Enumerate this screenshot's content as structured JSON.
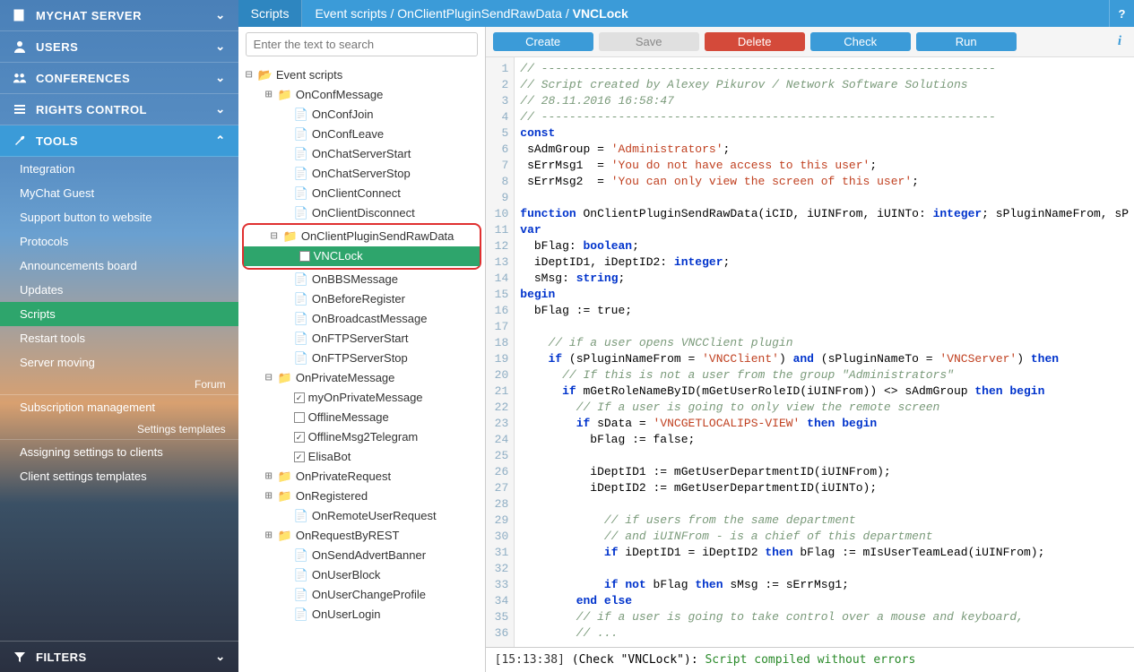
{
  "sidebar": {
    "sections": [
      {
        "label": "MYCHAT SERVER",
        "icon": "book",
        "expanded": false
      },
      {
        "label": "USERS",
        "icon": "user",
        "expanded": false
      },
      {
        "label": "CONFERENCES",
        "icon": "users",
        "expanded": false
      },
      {
        "label": "RIGHTS CONTROL",
        "icon": "list",
        "expanded": false
      },
      {
        "label": "TOOLS",
        "icon": "wrench",
        "expanded": true
      }
    ],
    "tools_items": [
      "Integration",
      "MyChat Guest",
      "Support button to website",
      "Protocols",
      "Announcements board",
      "Updates",
      "Scripts",
      "Restart tools",
      "Server moving"
    ],
    "tools_active": "Scripts",
    "forum_label": "Forum",
    "subscription": "Subscription management",
    "settings_templates": "Settings templates",
    "assigning": "Assigning settings to clients",
    "client_templates": "Client settings templates",
    "filters": "FILTERS"
  },
  "topbar": {
    "tab": "Scripts",
    "breadcrumb": "Event scripts / OnClientPluginSendRawData / VNCLock",
    "breadcrumb_parts": [
      "Event scripts",
      "OnClientPluginSendRawData",
      "VNCLock"
    ],
    "help": "?"
  },
  "search": {
    "placeholder": "Enter the text to search"
  },
  "tree": {
    "root": "Event scripts",
    "nodes": [
      {
        "l": 1,
        "exp": "+",
        "icon": "folder",
        "label": "OnConfMessage"
      },
      {
        "l": 2,
        "icon": "doc",
        "label": "OnConfJoin"
      },
      {
        "l": 2,
        "icon": "doc",
        "label": "OnConfLeave"
      },
      {
        "l": 2,
        "icon": "doc",
        "label": "OnChatServerStart"
      },
      {
        "l": 2,
        "icon": "doc",
        "label": "OnChatServerStop"
      },
      {
        "l": 2,
        "icon": "doc",
        "label": "OnClientConnect"
      },
      {
        "l": 2,
        "icon": "doc",
        "label": "OnClientDisconnect"
      },
      {
        "highlight_start": true
      },
      {
        "l": 1,
        "exp": "-",
        "icon": "folder",
        "label": "OnClientPluginSendRawData"
      },
      {
        "l": 2,
        "icon": "chk-on",
        "label": "VNCLock",
        "selected": true
      },
      {
        "highlight_end": true
      },
      {
        "l": 2,
        "icon": "doc",
        "label": "OnBBSMessage"
      },
      {
        "l": 2,
        "icon": "doc",
        "label": "OnBeforeRegister"
      },
      {
        "l": 2,
        "icon": "doc",
        "label": "OnBroadcastMessage"
      },
      {
        "l": 2,
        "icon": "doc",
        "label": "OnFTPServerStart"
      },
      {
        "l": 2,
        "icon": "doc",
        "label": "OnFTPServerStop"
      },
      {
        "l": 1,
        "exp": "-",
        "icon": "folder",
        "label": "OnPrivateMessage"
      },
      {
        "l": 2,
        "icon": "chk-on",
        "label": "myOnPrivateMessage"
      },
      {
        "l": 2,
        "icon": "chk-off",
        "label": "OfflineMessage"
      },
      {
        "l": 2,
        "icon": "chk-on",
        "label": "OfflineMsg2Telegram"
      },
      {
        "l": 2,
        "icon": "chk-on",
        "label": "ElisaBot"
      },
      {
        "l": 1,
        "exp": "+",
        "icon": "folder",
        "label": "OnPrivateRequest"
      },
      {
        "l": 1,
        "exp": "+",
        "icon": "folder",
        "label": "OnRegistered"
      },
      {
        "l": 2,
        "icon": "doc",
        "label": "OnRemoteUserRequest"
      },
      {
        "l": 1,
        "exp": "+",
        "icon": "folder",
        "label": "OnRequestByREST"
      },
      {
        "l": 2,
        "icon": "doc",
        "label": "OnSendAdvertBanner"
      },
      {
        "l": 2,
        "icon": "doc",
        "label": "OnUserBlock"
      },
      {
        "l": 2,
        "icon": "doc",
        "label": "OnUserChangeProfile"
      },
      {
        "l": 2,
        "icon": "doc",
        "label": "OnUserLogin"
      }
    ]
  },
  "toolbar": {
    "create": "Create",
    "save": "Save",
    "delete": "Delete",
    "check": "Check",
    "run": "Run",
    "info": "i"
  },
  "code": {
    "lines": [
      {
        "n": 1,
        "t": "comment",
        "s": "// -----------------------------------------------------------------"
      },
      {
        "n": 2,
        "t": "comment",
        "s": "// Script created by Alexey Pikurov / Network Software Solutions"
      },
      {
        "n": 3,
        "t": "comment",
        "s": "// 28.11.2016 16:58:47"
      },
      {
        "n": 4,
        "t": "comment",
        "s": "// -----------------------------------------------------------------"
      },
      {
        "n": 5,
        "t": "kw",
        "s": "const"
      },
      {
        "n": 6,
        "t": "assign",
        "id": " sAdmGroup",
        "eq": " = ",
        "str": "'Administrators'",
        "tail": ";"
      },
      {
        "n": 7,
        "t": "assign",
        "id": " sErrMsg1 ",
        "eq": " = ",
        "str": "'You do not have access to this user'",
        "tail": ";"
      },
      {
        "n": 8,
        "t": "assign",
        "id": " sErrMsg2 ",
        "eq": " = ",
        "str": "'You can only view the screen of this user'",
        "tail": ";"
      },
      {
        "n": 9,
        "t": "blank",
        "s": ""
      },
      {
        "n": 10,
        "t": "func",
        "s": "function OnClientPluginSendRawData(iCID, iUINFrom, iUINTo: integer; sPluginNameFrom, sP"
      },
      {
        "n": 11,
        "t": "kw",
        "s": "var"
      },
      {
        "n": 12,
        "t": "decl",
        "id": "  bFlag: ",
        "ty": "boolean",
        "tail": ";"
      },
      {
        "n": 13,
        "t": "decl",
        "id": "  iDeptID1, iDeptID2: ",
        "ty": "integer",
        "tail": ";"
      },
      {
        "n": 14,
        "t": "decl",
        "id": "  sMsg: ",
        "ty": "string",
        "tail": ";"
      },
      {
        "n": 15,
        "t": "kw",
        "s": "begin"
      },
      {
        "n": 16,
        "t": "plain",
        "s": "  bFlag := true;"
      },
      {
        "n": 17,
        "t": "blank",
        "s": ""
      },
      {
        "n": 18,
        "t": "comment",
        "s": "    // if a user opens VNCClient plugin"
      },
      {
        "n": 19,
        "t": "ifline",
        "pre": "    ",
        "s": "if (sPluginNameFrom = 'VNCClient') and (sPluginNameTo = 'VNCServer') then"
      },
      {
        "n": 20,
        "t": "comment",
        "s": "      // If this is not a user from the group \"Administrators\""
      },
      {
        "n": 21,
        "t": "ifline",
        "pre": "      ",
        "s": "if mGetRoleNameByID(mGetUserRoleID(iUINFrom)) <> sAdmGroup then begin"
      },
      {
        "n": 22,
        "t": "comment",
        "s": "        // If a user is going to only view the remote screen"
      },
      {
        "n": 23,
        "t": "ifline",
        "pre": "        ",
        "s": "if sData = 'VNCGETLOCALIPS-VIEW' then begin"
      },
      {
        "n": 24,
        "t": "plain",
        "s": "          bFlag := false;"
      },
      {
        "n": 25,
        "t": "blank",
        "s": ""
      },
      {
        "n": 26,
        "t": "plain",
        "s": "          iDeptID1 := mGetUserDepartmentID(iUINFrom);"
      },
      {
        "n": 27,
        "t": "plain",
        "s": "          iDeptID2 := mGetUserDepartmentID(iUINTo);"
      },
      {
        "n": 28,
        "t": "blank",
        "s": ""
      },
      {
        "n": 29,
        "t": "comment",
        "s": "            // if users from the same department"
      },
      {
        "n": 30,
        "t": "comment",
        "s": "            // and iUINFrom - is a chief of this department"
      },
      {
        "n": 31,
        "t": "ifline",
        "pre": "            ",
        "s": "if iDeptID1 = iDeptID2 then bFlag := mIsUserTeamLead(iUINFrom);"
      },
      {
        "n": 32,
        "t": "blank",
        "s": ""
      },
      {
        "n": 33,
        "t": "ifline",
        "pre": "            ",
        "s": "if not bFlag then sMsg := sErrMsg1;"
      },
      {
        "n": 34,
        "t": "endelse",
        "pre": "        ",
        "s": "end else"
      },
      {
        "n": 35,
        "t": "comment",
        "s": "        // if a user is going to take control over a mouse and keyboard,"
      },
      {
        "n": 36,
        "t": "comment",
        "s": "        // ..."
      }
    ]
  },
  "console": {
    "timestamp": "[15:13:38]",
    "prefix": " (Check \"VNCLock\"): ",
    "message": "Script compiled without errors"
  }
}
